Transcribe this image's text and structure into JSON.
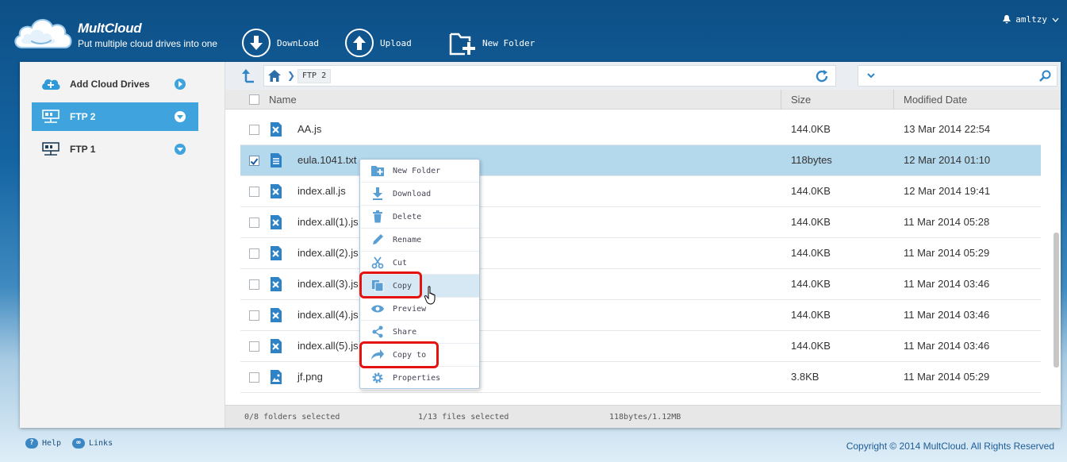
{
  "brand": {
    "name": "MultCloud",
    "tagline": "Put multiple cloud drives into one"
  },
  "toolbar": {
    "download": "DownLoad",
    "upload": "Upload",
    "new_folder": "New Folder"
  },
  "user": {
    "name": "amltzy"
  },
  "sidebar": {
    "items": [
      {
        "label": "Add Cloud Drives",
        "icon": "plus-cloud-icon"
      },
      {
        "label": "FTP 2",
        "icon": "ftp-server-icon",
        "active": true
      },
      {
        "label": "FTP 1",
        "icon": "ftp-server-icon"
      }
    ]
  },
  "breadcrumb": {
    "current": "FTP 2"
  },
  "columns": {
    "name": "Name",
    "size": "Size",
    "modified": "Modified Date"
  },
  "files": [
    {
      "name": "AA.js",
      "size": "144.0KB",
      "date": "13 Mar 2014 22:54",
      "type": "js"
    },
    {
      "name": "eula.1041.txt",
      "size": "118bytes",
      "date": "12 Mar 2014 01:10",
      "type": "txt",
      "selected": true
    },
    {
      "name": "index.all.js",
      "size": "144.0KB",
      "date": "12 Mar 2014 19:41",
      "type": "js"
    },
    {
      "name": "index.all(1).js",
      "size": "144.0KB",
      "date": "11 Mar 2014 05:28",
      "type": "js"
    },
    {
      "name": "index.all(2).js",
      "size": "144.0KB",
      "date": "11 Mar 2014 05:29",
      "type": "js"
    },
    {
      "name": "index.all(3).js",
      "size": "144.0KB",
      "date": "11 Mar 2014 03:46",
      "type": "js"
    },
    {
      "name": "index.all(4).js",
      "size": "144.0KB",
      "date": "11 Mar 2014 03:46",
      "type": "js"
    },
    {
      "name": "index.all(5).js",
      "size": "144.0KB",
      "date": "11 Mar 2014 03:46",
      "type": "js"
    },
    {
      "name": "jf.png",
      "size": "3.8KB",
      "date": "11 Mar 2014 05:29",
      "type": "png"
    }
  ],
  "status": {
    "folders": "0/8 folders selected",
    "files": "1/13 files selected",
    "size": "118bytes/1.12MB"
  },
  "context_menu": [
    {
      "label": "New Folder",
      "icon": "new-folder-icon"
    },
    {
      "label": "Download",
      "icon": "download-icon"
    },
    {
      "label": "Delete",
      "icon": "trash-icon"
    },
    {
      "label": "Rename",
      "icon": "pencil-icon"
    },
    {
      "label": "Cut",
      "icon": "scissors-icon"
    },
    {
      "label": "Copy",
      "icon": "copy-icon",
      "hover": true
    },
    {
      "label": "Preview",
      "icon": "eye-icon"
    },
    {
      "label": "Share",
      "icon": "share-icon"
    },
    {
      "label": "Copy to",
      "icon": "copy-to-icon"
    },
    {
      "label": "Properties",
      "icon": "gear-icon"
    }
  ],
  "footer": {
    "help": "Help",
    "links": "Links",
    "copyright": "Copyright © 2014 MultCloud. All Rights Reserved"
  },
  "colors": {
    "accent": "#3fa4de",
    "selected_row": "#b4d8ec",
    "highlight": "#e4130f"
  }
}
